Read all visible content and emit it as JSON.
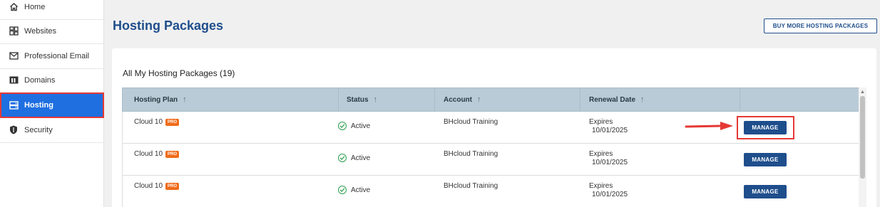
{
  "sidebar": {
    "items": [
      {
        "label": "Home",
        "icon": "home-icon"
      },
      {
        "label": "Websites",
        "icon": "websites-icon"
      },
      {
        "label": "Professional Email",
        "icon": "mail-icon"
      },
      {
        "label": "Domains",
        "icon": "domains-icon"
      },
      {
        "label": "Hosting",
        "icon": "hosting-icon",
        "active": true
      },
      {
        "label": "Security",
        "icon": "shield-icon"
      }
    ]
  },
  "header": {
    "title": "Hosting Packages",
    "buy_button": "BUY MORE HOSTING PACKAGES"
  },
  "section": {
    "title": "All My Hosting Packages (19)"
  },
  "table": {
    "columns": [
      "Hosting Plan",
      "Status",
      "Account",
      "Renewal Date"
    ],
    "rows": [
      {
        "plan": "Cloud 10",
        "badge": "PRO",
        "status": "Active",
        "account": "BHcloud Training",
        "renew_label": "Expires",
        "renew_date": "10/01/2025",
        "action": "MANAGE"
      },
      {
        "plan": "Cloud 10",
        "badge": "PRO",
        "status": "Active",
        "account": "BHcloud Training",
        "renew_label": "Expires",
        "renew_date": "10/01/2025",
        "action": "MANAGE"
      },
      {
        "plan": "Cloud 10",
        "badge": "PRO",
        "status": "Active",
        "account": "BHcloud Training",
        "renew_label": "Expires",
        "renew_date": "10/01/2025",
        "action": "MANAGE"
      }
    ]
  },
  "colors": {
    "brand": "#1f4e8c",
    "active_nav": "#1f6fe0",
    "annotation": "#e53935",
    "pro_badge": "#ef6c1a",
    "status_ok": "#2e9e4f"
  }
}
